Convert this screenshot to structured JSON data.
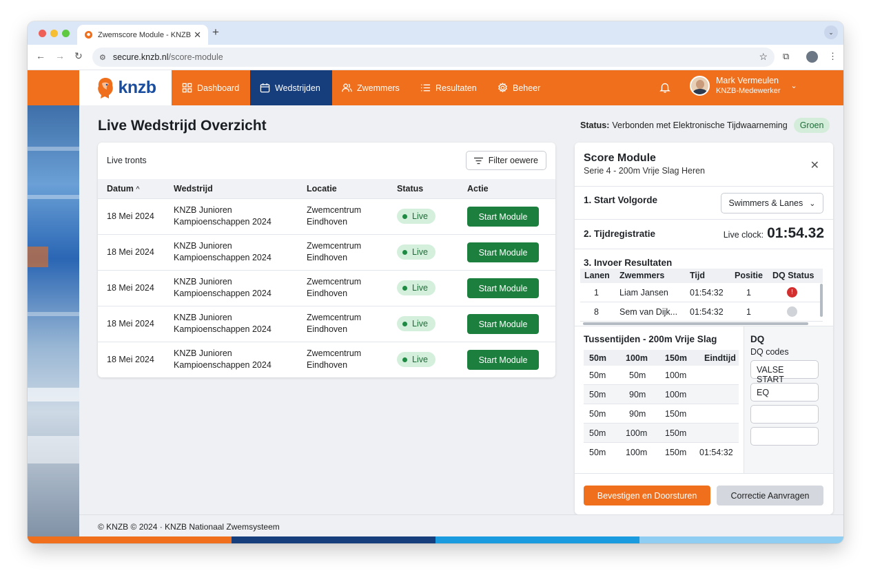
{
  "browser": {
    "tab_title": "Zwemscore Module - KNZB",
    "new_tab": "+",
    "url_host": "secure.knzb.nl",
    "url_path": "/score-module"
  },
  "nav": {
    "logo_text": "knzb",
    "items": [
      {
        "label": "Dashboard",
        "icon": "dashboard-icon"
      },
      {
        "label": "Wedstrijden",
        "icon": "calendar-icon",
        "active": true
      },
      {
        "label": "Zwemmers",
        "icon": "users-icon"
      },
      {
        "label": "Resultaten",
        "icon": "list-icon"
      },
      {
        "label": "Beheer",
        "icon": "gear-icon"
      }
    ],
    "user": {
      "name": "Mark Vermeulen",
      "role": "KNZB-Medewerker"
    }
  },
  "page": {
    "title": "Live Wedstrijd Overzicht",
    "status_label": "Status:",
    "status_text": "Verbonden met Elektronische Tijdwaarneming",
    "status_badge": "Groen",
    "colors": {
      "brand_orange": "#ef6f1c",
      "brand_blue": "#163d7c",
      "live_green": "#1c7f3e"
    }
  },
  "events": {
    "title": "Live tronts",
    "filter_label": "Filter oewere",
    "columns": [
      "Datum",
      "Wedstrijd",
      "Locatie",
      "Status",
      "Actie"
    ],
    "rows": [
      {
        "date": "18 Mei 2024",
        "event_l1": "KNZB Junioren",
        "event_l2": "Kampioenschappen 2024",
        "loc_l1": "Zwemcentrum",
        "loc_l2": "Eindhoven",
        "status": "Live",
        "action": "Start Module"
      },
      {
        "date": "18 Mei 2024",
        "event_l1": "KNZB Junioren",
        "event_l2": "Kampioenschappen 2024",
        "loc_l1": "Zwemcentrum",
        "loc_l2": "Eindhoven",
        "status": "Live",
        "action": "Start Module"
      },
      {
        "date": "18 Mei 2024",
        "event_l1": "KNZB Junioren",
        "event_l2": "Kampioenschappen 2024",
        "loc_l1": "Zwemcentrum",
        "loc_l2": "Eindhoven",
        "status": "Live",
        "action": "Start Module"
      },
      {
        "date": "18 Mei 2024",
        "event_l1": "KNZB Junioren",
        "event_l2": "Kampioenschappen 2024",
        "loc_l1": "Zwemcentrum",
        "loc_l2": "Eindhoven",
        "status": "Live",
        "action": "Start Module"
      },
      {
        "date": "18 Mei 2024",
        "event_l1": "KNZB Junioren",
        "event_l2": "Kampioenschappen 2024",
        "loc_l1": "Zwemcentrum",
        "loc_l2": "Eindhoven",
        "status": "Live",
        "action": "Start Module"
      }
    ]
  },
  "score": {
    "title": "Score Module",
    "subtitle": "Serie 4 - 200m Vrije Slag Heren",
    "sec1": "1. Start Volgorde",
    "sec1_select": "Swimmers & Lanes",
    "sec2": "2. Tijdregistratie",
    "clock_label": "Live clock:",
    "clock_value": "01:54.32",
    "sec3": "3. Invoer Resultaten",
    "res_columns": [
      "Lanen",
      "Zwemmers",
      "Tijd",
      "Positie",
      "DQ Status"
    ],
    "res_rows": [
      {
        "lane": "1",
        "swimmer": "Liam Jansen",
        "time": "01:54:32",
        "pos": "1",
        "dq": "red"
      },
      {
        "lane": "8",
        "swimmer": "Sem van Dijk...",
        "time": "01:54:32",
        "pos": "1",
        "dq": "grey"
      }
    ],
    "splits_title": "Tussentijden - 200m Vrije Slag",
    "split_columns": [
      "50m",
      "100m",
      "150m",
      "Eindtijd"
    ],
    "split_rows": [
      [
        "50m",
        "50m",
        "100m",
        ""
      ],
      [
        "50m",
        "90m",
        "100m",
        ""
      ],
      [
        "50m",
        "90m",
        "150m",
        ""
      ],
      [
        "50m",
        "100m",
        "150m",
        ""
      ],
      [
        "50m",
        "100m",
        "150m",
        "01:54:32"
      ]
    ],
    "dq_title": "DQ",
    "dq_sub": "DQ codes",
    "dq_codes": [
      "VALSE START",
      "EQ",
      "",
      ""
    ],
    "confirm": "Bevestigen en Doorsturen",
    "correction": "Correctie Aanvragen"
  },
  "footer": {
    "text": "© KNZB © 2024 · KNZB Nationaal Zwemsysteem"
  }
}
